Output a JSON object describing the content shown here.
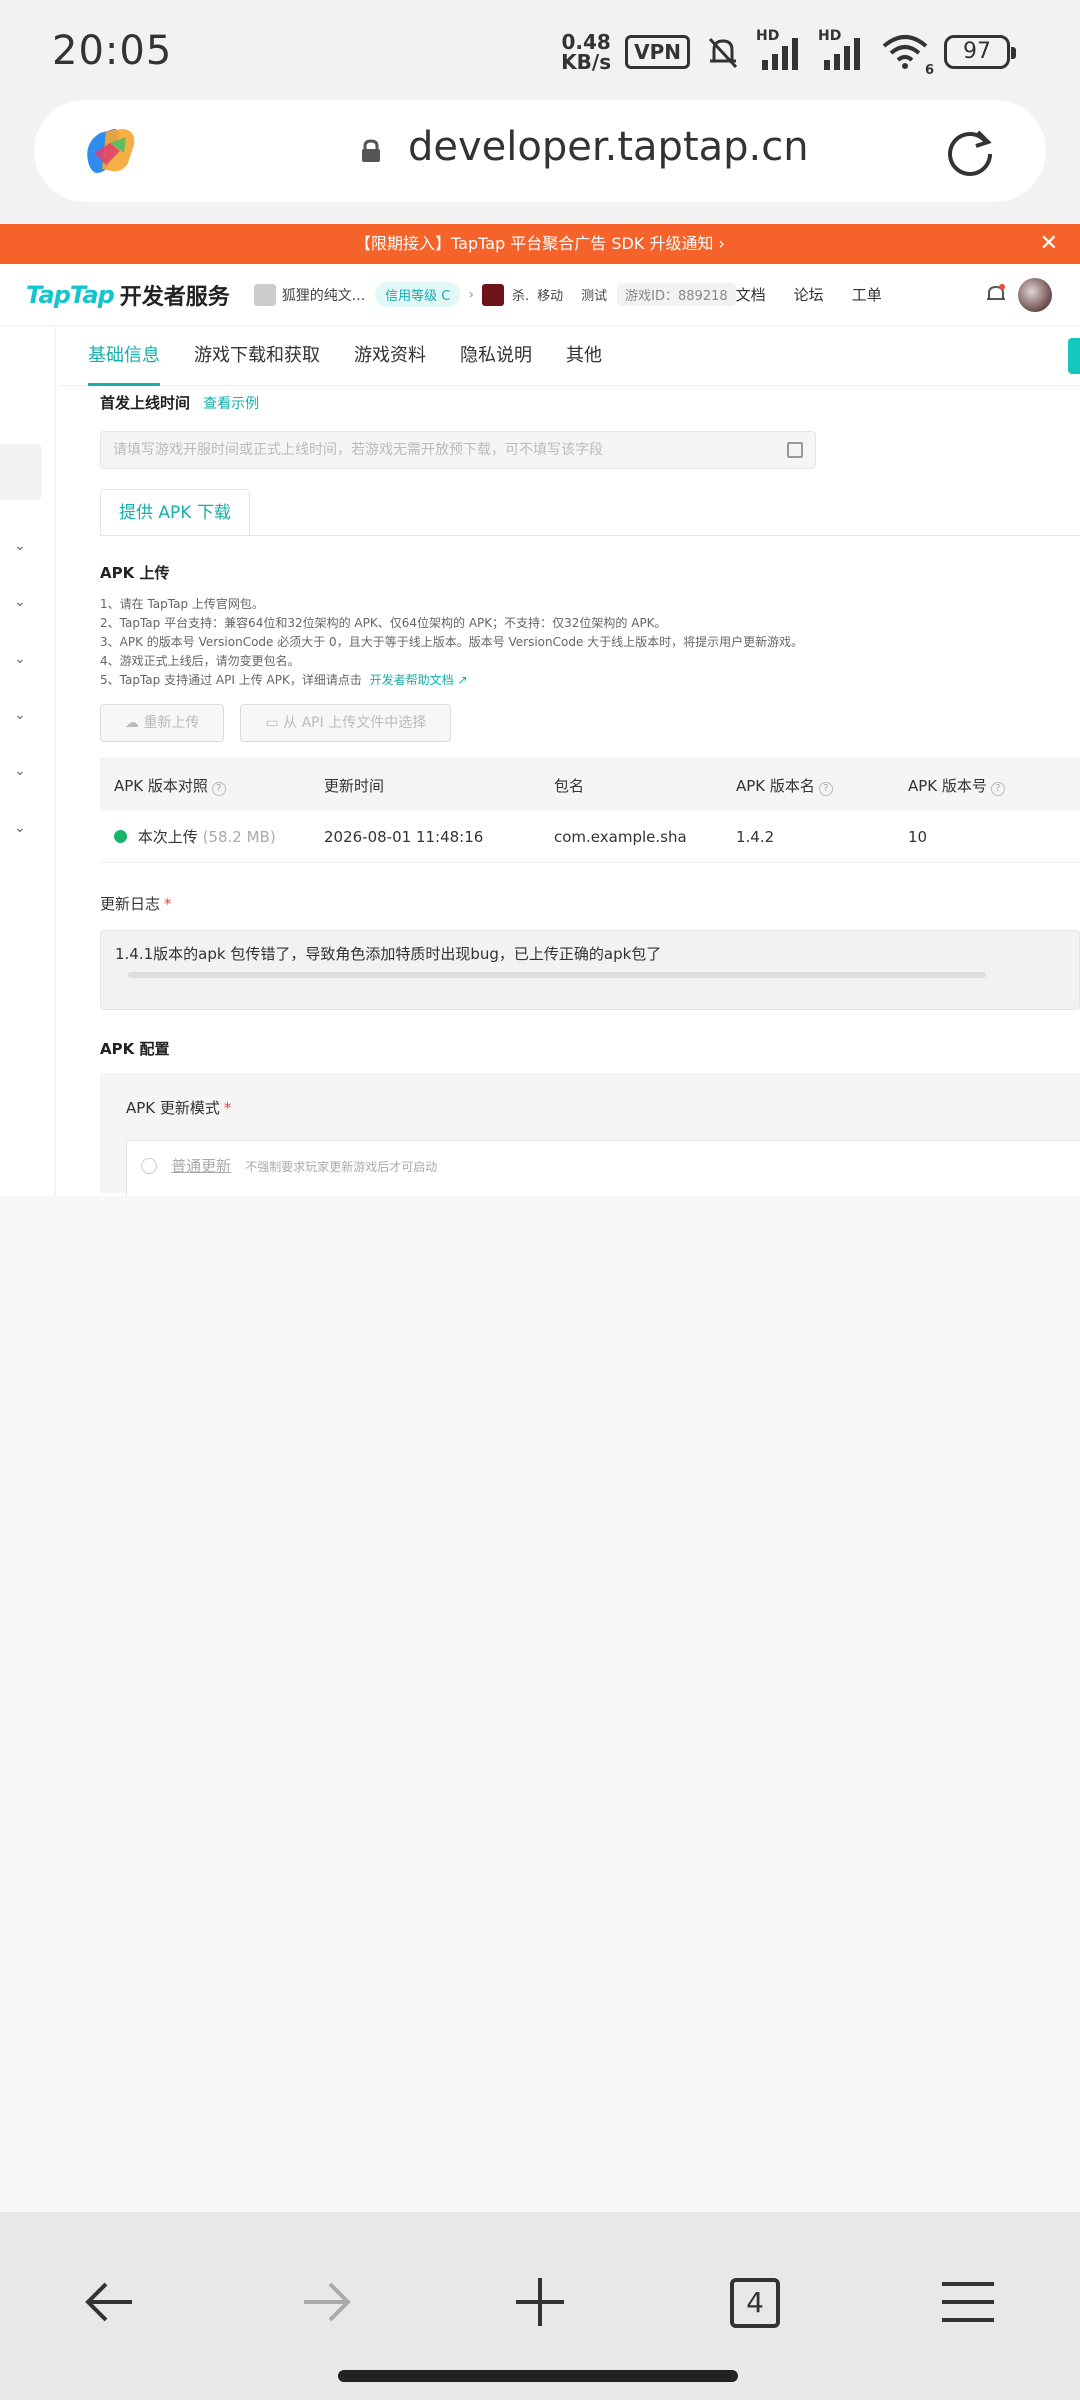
{
  "status_bar": {
    "time": "20:05",
    "net_speed_value": "0.48",
    "net_speed_unit": "KB/s",
    "vpn_label": "VPN",
    "hd1": "HD",
    "hd2": "HD",
    "wifi_index": "6",
    "battery": "97"
  },
  "browser": {
    "url": "developer.taptap.cn",
    "tabs_count": "4"
  },
  "page": {
    "banner": "【限期接入】TapTap 平台聚合广告 SDK 升级通知 ›",
    "banner_close": "✕",
    "header": {
      "logo": "TapTap",
      "logo_cn": "开发者服务",
      "app_name": "狐狸的纯文...",
      "credit_badge": "信用等级 C",
      "separator": "›",
      "game_label": "杀.",
      "platform": "移动",
      "test_label": "测试",
      "game_id": "游戏ID：889218",
      "links": [
        "文档",
        "论坛",
        "工单"
      ]
    },
    "tabs": [
      "基础信息",
      "游戏下载和获取",
      "游戏资料",
      "隐私说明",
      "其他"
    ],
    "first_launch_label": "首发上线时间",
    "view_example": "查看示例",
    "date_placeholder": "请填写游戏开服时间或正式上线时间，若游戏无需开放预下载，可不填写该字段",
    "apk_tab": "提供 APK 下载",
    "apk_upload_title": "APK 上传",
    "notes": [
      "1、请在 TapTap 上传官网包。",
      "2、TapTap 平台支持：兼容64位和32位架构的 APK、仅64位架构的 APK；不支持：仅32位架构的 APK。",
      "3、APK 的版本号 VersionCode 必须大于 0，且大于等于线上版本。版本号 VersionCode 大于线上版本时，将提示用户更新游戏。",
      "4、游戏正式上线后，请勿变更包名。",
      "5、TapTap 支持通过 API 上传 APK，详细请点击"
    ],
    "help_doc_link": "开发者帮助文档",
    "reupload_btn": "重新上传",
    "api_pick_btn": "从 API 上传文件中选择",
    "table": {
      "headers": [
        "APK 版本对照",
        "更新时间",
        "包名",
        "APK 版本名",
        "APK 版本号"
      ],
      "row": {
        "label": "本次上传",
        "size": "(58.2 MB)",
        "time": "2026-08-01 11:48:16",
        "package": "com.example.sha",
        "version_name": "1.4.2",
        "version_code": "10"
      }
    },
    "changelog_label": "更新日志",
    "required_mark": "*",
    "changelog_text": "1.4.1版本的apk 包传错了，导致角色添加特质时出现bug，已上传正确的apk包了",
    "apk_config_title": "APK 配置",
    "update_mode_label": "APK 更新模式",
    "radio_normal": "普通更新",
    "radio_normal_hint": "不强制要求玩家更新游戏后才可启动"
  },
  "colors": {
    "accent": "#14b0ae",
    "banner": "#f5622a"
  }
}
